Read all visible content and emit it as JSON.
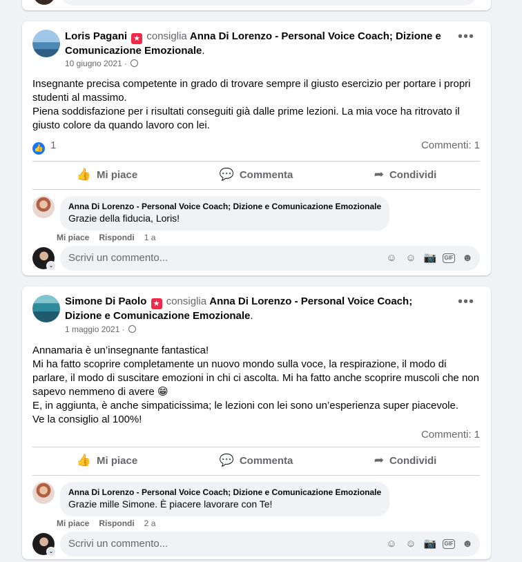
{
  "labels": {
    "verb": "consiglia",
    "like": "Mi piace",
    "comment": "Commenta",
    "share": "Condividi",
    "reply": "Rispondi",
    "write_placeholder": "Scrivi un commento..."
  },
  "posts": [
    {
      "author": "Loris Pagani",
      "page": "Anna Di Lorenzo - Personal Voice Coach; Dizione e Comunicazione Emozionale",
      "date": "10 giugno 2021 ·",
      "body": "Insegnante precisa competente in grado di trovare sempre il giusto esercizio per portare i propri studenti al massimo.\nPiena soddisfazione per i risultati conseguiti già dalle prime lezioni.  La mia voce ha ritrovato il giusto colore da quando lavoro con lei.",
      "reactions": "1",
      "comments_count": "Commenti: 1",
      "reply": {
        "author": "Anna Di Lorenzo - Personal Voice Coach; Dizione e Comunicazione Emozionale",
        "text": "Grazie della fiducia, Loris!",
        "age": "1 a"
      }
    },
    {
      "author": "Simone Di Paolo",
      "page": "Anna Di Lorenzo - Personal Voice Coach; Dizione e Comunicazione Emozionale",
      "date": "1 maggio 2021 ·",
      "body": "Annamaria è un’insegnante fantastica!\nMi ha fatto scoprire completamente un nuovo mondo sulla voce, la respirazione, il modo di parlare, il modo di suscitare emozioni in chi ci ascolta. Mi ha fatto anche scoprire muscoli che non sapevo nemmeno di avere 😁\nE, in aggiunta, è anche simpaticissima; le lezioni con lei sono un’esperienza super piacevole.\nVe la consiglio al 100%!",
      "comments_count": "Commenti: 1",
      "reply": {
        "author": "Anna Di Lorenzo - Personal Voice Coach; Dizione e Comunicazione Emozionale",
        "text": "Grazie mille Simone. È piacere lavorare con Te!",
        "age": "2 a"
      }
    }
  ],
  "icons": {
    "recommend": "recommend-badge-icon",
    "privacy": "globe-icon",
    "like": "thumbs-up-icon",
    "comment": "speech-bubble-icon",
    "share": "share-arrow-icon"
  },
  "colors": {
    "like_blue": "#1877f2",
    "recommend_red": "#f02849",
    "secondary_text": "#65676b"
  }
}
